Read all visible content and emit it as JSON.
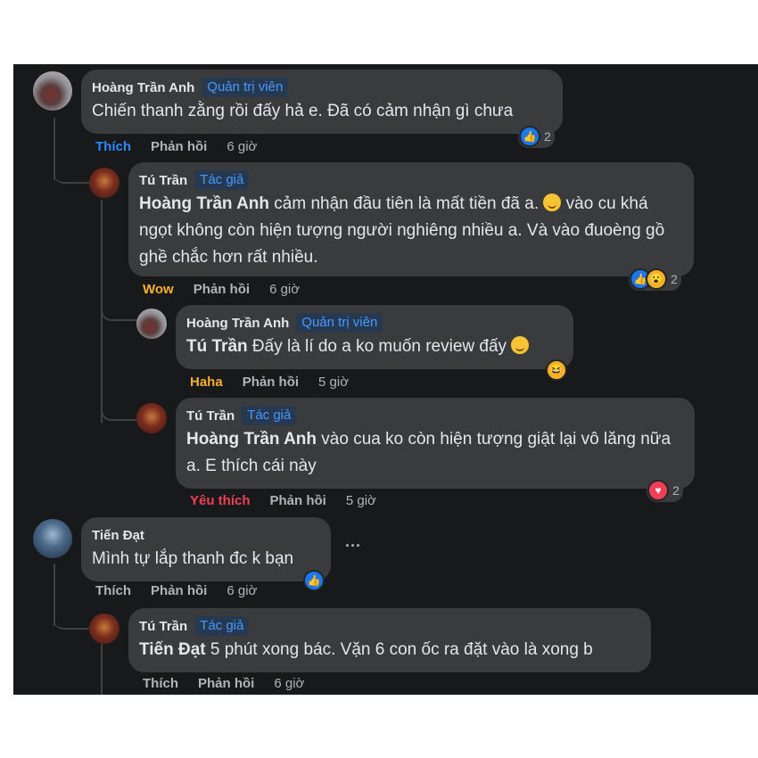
{
  "comments": [
    {
      "author": "Hoàng Trần Anh",
      "badge": "Quản trị viên",
      "text": "Chiến thanh zằng rồi đấy hả e. Đã có cảm nhận gì chưa",
      "reaction_label": "Thích",
      "reply": "Phản hồi",
      "time": "6 giờ",
      "react_count": "2"
    },
    {
      "author": "Tú Trần",
      "badge": "Tác giả",
      "mention": "Hoàng Trần Anh",
      "text": " cảm nhận đầu tiên là mất tiền đã a. ",
      "text2": " vào cu khá ngọt không còn hiện tượng người nghiêng nhiều a. Và vào đuoèng gồ ghề chắc hơn rất nhiều.",
      "reaction_label": "Wow",
      "reply": "Phản hồi",
      "time": "6 giờ",
      "react_count": "2"
    },
    {
      "author": "Hoàng Trần Anh",
      "badge": "Quản trị viên",
      "mention": "Tú Trần",
      "text": " Đấy là lí do a ko muốn review đấy ",
      "reaction_label": "Haha",
      "reply": "Phản hồi",
      "time": "5 giờ"
    },
    {
      "author": "Tú Trần",
      "badge": "Tác giả",
      "mention": "Hoàng Trần Anh",
      "text": " vào cua ko còn hiện tượng giật lại vô lăng nữa a. E thích cái này",
      "reaction_label": "Yêu thích",
      "reply": "Phản hồi",
      "time": "5 giờ",
      "react_count": "2"
    },
    {
      "author": "Tiến Đạt",
      "text": "Mình tự lắp thanh đc k bạn",
      "reaction_label": "Thích",
      "reply": "Phản hồi",
      "time": "6 giờ",
      "more": "···"
    },
    {
      "author": "Tú Trần",
      "badge": "Tác giả",
      "mention": "Tiến Đạt",
      "text": " 5 phút xong bác. Vặn 6 con ốc ra đặt vào là xong b",
      "reaction_label": "Thích",
      "reply": "Phản hồi",
      "time": "6 giờ"
    }
  ],
  "colors": {
    "panel": "#18191a",
    "bubble": "#3a3b3c",
    "like": "#1877f2",
    "wow": "#f7b125",
    "haha": "#f7b125",
    "love": "#f33e58"
  },
  "icons": [
    "like-icon",
    "wow-icon",
    "haha-icon",
    "heart-icon",
    "smile-emoji-icon",
    "more-options-icon"
  ]
}
